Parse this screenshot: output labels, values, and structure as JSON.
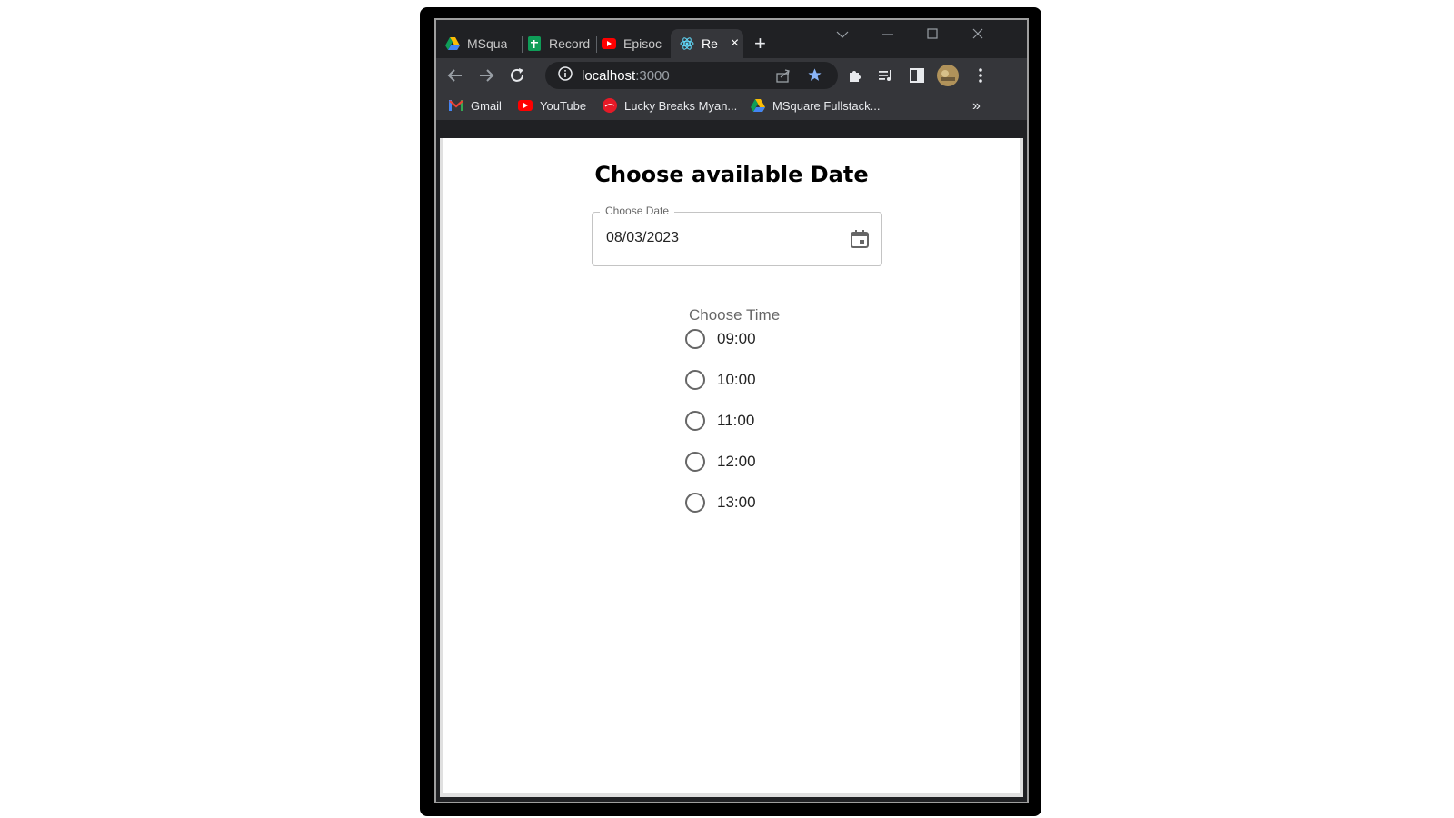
{
  "browser": {
    "tabs": [
      {
        "label": "MSqua",
        "icon": "google-drive-icon"
      },
      {
        "label": "Record",
        "icon": "google-sheets-icon"
      },
      {
        "label": "Episoc",
        "icon": "youtube-icon"
      },
      {
        "label": "Re",
        "icon": "react-icon",
        "active": true
      }
    ],
    "new_tab_label": "+",
    "close_tab_label": "×",
    "url_host": "localhost",
    "url_port": ":3000",
    "bookmarks": [
      {
        "label": "Gmail",
        "icon": "gmail-icon"
      },
      {
        "label": "YouTube",
        "icon": "youtube-icon"
      },
      {
        "label": "Lucky Breaks Myan...",
        "icon": "coca-cola-icon"
      },
      {
        "label": "MSquare Fullstack...",
        "icon": "google-drive-icon"
      }
    ],
    "bookmarks_overflow": "»"
  },
  "page": {
    "title": "Choose available Date",
    "date_field": {
      "label": "Choose Date",
      "value": "08/03/2023"
    },
    "time_label": "Choose Time",
    "times": [
      "09:00",
      "10:00",
      "11:00",
      "12:00",
      "13:00"
    ]
  },
  "colors": {
    "chrome_dark": "#202124",
    "toolbar": "#35363a",
    "star_blue": "#8ab4f8"
  }
}
